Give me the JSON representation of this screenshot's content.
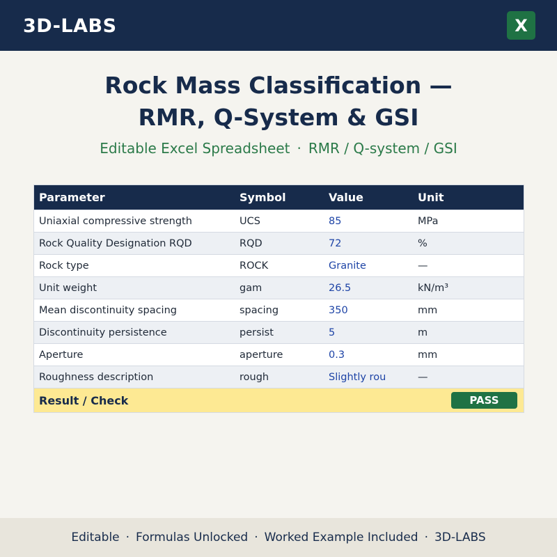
{
  "header": {
    "brand": "3D-LABS",
    "excel_icon_letter": "X",
    "colors": {
      "background": "#172b4b",
      "excel": "#1f7244"
    }
  },
  "title": {
    "line1": "Rock Mass Classification —",
    "line2": "RMR, Q-System & GSI"
  },
  "subtitle": {
    "part1": "Editable Excel Spreadsheet",
    "separator": "·",
    "part2": "RMR / Q-system / GSI"
  },
  "table": {
    "headers": [
      "Parameter",
      "Symbol",
      "Value",
      "Unit"
    ],
    "rows": [
      [
        "Uniaxial compressive strength",
        "UCS",
        "85",
        "MPa"
      ],
      [
        "Rock Quality Designation RQD",
        "RQD",
        "72",
        "%"
      ],
      [
        "Rock type",
        "ROCK",
        "Granite",
        "—"
      ],
      [
        "Unit weight",
        "gam",
        "26.5",
        "kN/m³"
      ],
      [
        "Mean discontinuity spacing",
        "spacing",
        "350",
        "mm"
      ],
      [
        "Discontinuity persistence",
        "persist",
        "5",
        "m"
      ],
      [
        "Aperture",
        "aperture",
        "0.3",
        "mm"
      ],
      [
        "Roughness description",
        "rough",
        "Slightly rou",
        "—"
      ]
    ],
    "result_label": "Result / Check",
    "result_status": "PASS",
    "colors": {
      "header": "#172b4b",
      "value_text": "#1e44a6",
      "result_bg": "#fde993",
      "pass": "#1f7244"
    }
  },
  "footer": {
    "items": [
      "Editable",
      "Formulas Unlocked",
      "Worked Example Included",
      "3D-LABS"
    ],
    "separator": "·"
  }
}
